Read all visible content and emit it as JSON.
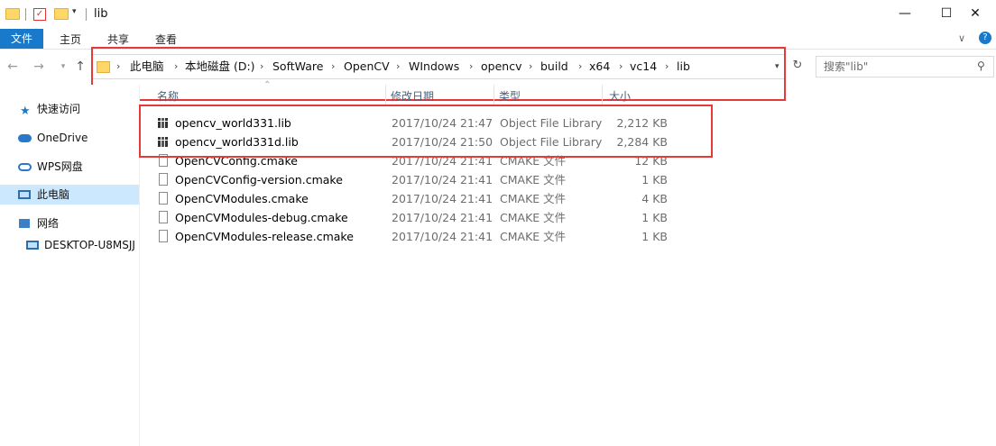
{
  "window": {
    "title": "lib",
    "controls": {
      "minimize": "—",
      "maximize": "☐",
      "close": "✕"
    }
  },
  "ribbon": {
    "tabs": [
      "文件",
      "主页",
      "共享",
      "查看"
    ],
    "help_icon": "?",
    "expand_icon": "∨"
  },
  "address": {
    "breadcrumbs": [
      "此电脑",
      "本地磁盘 (D:)",
      "SoftWare",
      "OpenCV",
      "WIndows",
      "opencv",
      "build",
      "x64",
      "vc14",
      "lib"
    ]
  },
  "search": {
    "placeholder": "搜索\"lib\""
  },
  "navpane": {
    "items": [
      {
        "label": "快速访问",
        "icon": "star-icon"
      },
      {
        "label": "OneDrive",
        "icon": "cloud-icon"
      },
      {
        "label": "WPS网盘",
        "icon": "cloud-icon"
      },
      {
        "label": "此电脑",
        "icon": "computer-icon",
        "selected": true
      },
      {
        "label": "网络",
        "icon": "network-icon"
      },
      {
        "label": "DESKTOP-U8MSJJ",
        "icon": "computer-icon"
      }
    ]
  },
  "columns": {
    "name": "名称",
    "date": "修改日期",
    "type": "类型",
    "size": "大小"
  },
  "files": [
    {
      "name": "opencv_world331.lib",
      "date": "2017/10/24 21:47",
      "type": "Object File Library",
      "size": "2,212 KB",
      "icon": "library-file-icon"
    },
    {
      "name": "opencv_world331d.lib",
      "date": "2017/10/24 21:50",
      "type": "Object File Library",
      "size": "2,284 KB",
      "icon": "library-file-icon"
    },
    {
      "name": "OpenCVConfig.cmake",
      "date": "2017/10/24 21:41",
      "type": "CMAKE 文件",
      "size": "12 KB",
      "icon": "document-icon"
    },
    {
      "name": "OpenCVConfig-version.cmake",
      "date": "2017/10/24 21:41",
      "type": "CMAKE 文件",
      "size": "1 KB",
      "icon": "document-icon"
    },
    {
      "name": "OpenCVModules.cmake",
      "date": "2017/10/24 21:41",
      "type": "CMAKE 文件",
      "size": "4 KB",
      "icon": "document-icon"
    },
    {
      "name": "OpenCVModules-debug.cmake",
      "date": "2017/10/24 21:41",
      "type": "CMAKE 文件",
      "size": "1 KB",
      "icon": "document-icon"
    },
    {
      "name": "OpenCVModules-release.cmake",
      "date": "2017/10/24 21:41",
      "type": "CMAKE 文件",
      "size": "1 KB",
      "icon": "document-icon"
    }
  ],
  "colors": {
    "accent": "#1979ca",
    "highlight_box": "#e53a3a",
    "selection": "#cce8ff"
  }
}
